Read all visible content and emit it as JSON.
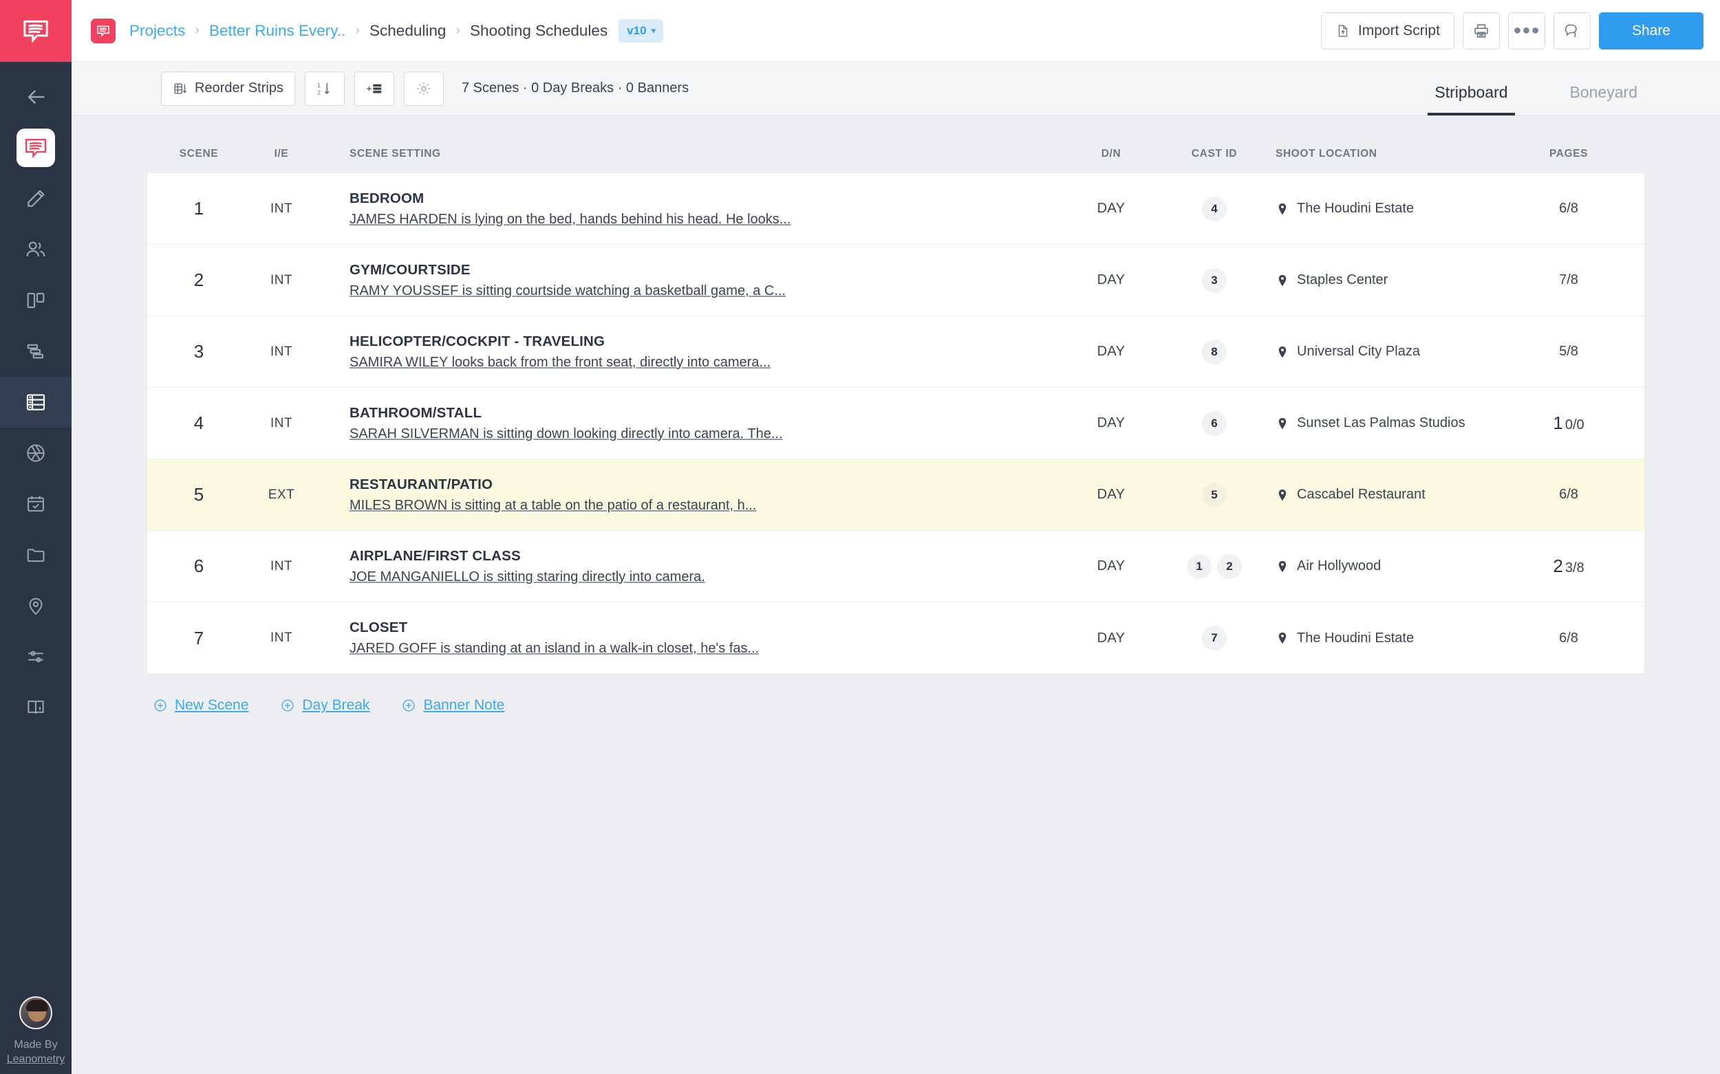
{
  "rail": {
    "brand_icon": "studiobinder-speech-logo",
    "items": [
      {
        "name": "back-arrow",
        "icon": "arrow-left-icon",
        "active": false
      },
      {
        "name": "script-logo",
        "icon": "speech-bubble-logo-icon",
        "active": false
      },
      {
        "name": "write",
        "icon": "pencil-icon",
        "active": false
      },
      {
        "name": "cast-crew",
        "icon": "people-icon",
        "active": false
      },
      {
        "name": "storyboard",
        "icon": "columns-icon",
        "active": false
      },
      {
        "name": "shot-list",
        "icon": "stacked-bars-icon",
        "active": false
      },
      {
        "name": "scheduling",
        "icon": "stripboard-icon",
        "active": true
      },
      {
        "name": "shooting",
        "icon": "camera-aperture-icon",
        "active": false
      },
      {
        "name": "calendar",
        "icon": "calendar-check-icon",
        "active": false
      },
      {
        "name": "files",
        "icon": "folder-icon",
        "active": false
      },
      {
        "name": "locations",
        "icon": "map-pin-icon",
        "active": false
      },
      {
        "name": "settings-sliders",
        "icon": "sliders-icon",
        "active": false
      },
      {
        "name": "help",
        "icon": "book-info-icon",
        "active": false
      }
    ],
    "footer": {
      "line1": "Made By",
      "line2": "Leanometry"
    }
  },
  "header": {
    "breadcrumbs": [
      {
        "label": "Projects",
        "link": true
      },
      {
        "label": "Better Ruins Every..",
        "link": true
      },
      {
        "label": "Scheduling",
        "link": false
      },
      {
        "label": "Shooting Schedules",
        "link": false
      }
    ],
    "separator": "›",
    "version_badge": {
      "label": "v10",
      "chevron": "⌄"
    },
    "import_button": "Import Script",
    "print_icon": "printer-icon",
    "more_icon": "ellipsis-icon",
    "comment_icon": "comment-bubble-icon",
    "share_button": "Share"
  },
  "toolbar": {
    "reorder_button": "Reorder Strips",
    "sort_icon": "sort-1-2-down-icon",
    "add_strip_icon": "add-strip-icon",
    "settings_icon": "gear-icon",
    "counts": "7 Scenes · 0 Day Breaks · 0 Banners",
    "tabs": [
      {
        "label": "Stripboard",
        "active": true
      },
      {
        "label": "Boneyard",
        "active": false
      }
    ]
  },
  "table": {
    "columns": [
      "SCENE",
      "I/E",
      "SCENE SETTING",
      "D/N",
      "CAST ID",
      "SHOOT LOCATION",
      "PAGES"
    ],
    "rows": [
      {
        "scene": "1",
        "ie": "INT",
        "title": "BEDROOM",
        "desc": "JAMES HARDEN is lying on the bed, hands behind his head. He looks...",
        "dn": "DAY",
        "cast": [
          "4"
        ],
        "location": "The Houdini Estate",
        "pages_whole": "",
        "pages_frac": "6/8",
        "highlighted": false
      },
      {
        "scene": "2",
        "ie": "INT",
        "title": "GYM/COURTSIDE",
        "desc": "RAMY YOUSSEF is sitting courtside watching a basketball game, a C...",
        "dn": "DAY",
        "cast": [
          "3"
        ],
        "location": "Staples Center",
        "pages_whole": "",
        "pages_frac": "7/8",
        "highlighted": false
      },
      {
        "scene": "3",
        "ie": "INT",
        "title": "HELICOPTER/COCKPIT - TRAVELING",
        "desc": "SAMIRA WILEY looks back from the front seat, directly into camera...",
        "dn": "DAY",
        "cast": [
          "8"
        ],
        "location": "Universal City Plaza",
        "pages_whole": "",
        "pages_frac": "5/8",
        "highlighted": false
      },
      {
        "scene": "4",
        "ie": "INT",
        "title": "BATHROOM/STALL",
        "desc": "SARAH SILVERMAN is sitting down looking directly into camera. The...",
        "dn": "DAY",
        "cast": [
          "6"
        ],
        "location": "Sunset Las Palmas Studios",
        "pages_whole": "1",
        "pages_frac": "0/0",
        "highlighted": false
      },
      {
        "scene": "5",
        "ie": "EXT",
        "title": "RESTAURANT/PATIO",
        "desc": "MILES BROWN is sitting at a table on the patio of a restaurant, h...",
        "dn": "DAY",
        "cast": [
          "5"
        ],
        "location": "Cascabel Restaurant",
        "pages_whole": "",
        "pages_frac": "6/8",
        "highlighted": true
      },
      {
        "scene": "6",
        "ie": "INT",
        "title": "AIRPLANE/FIRST CLASS",
        "desc": "JOE MANGANIELLO is sitting staring directly into camera.",
        "dn": "DAY",
        "cast": [
          "1",
          "2"
        ],
        "location": "Air Hollywood",
        "pages_whole": "2",
        "pages_frac": "3/8",
        "highlighted": false
      },
      {
        "scene": "7",
        "ie": "INT",
        "title": "CLOSET",
        "desc": "JARED GOFF is standing at an island in a walk-in closet, he's fas...",
        "dn": "DAY",
        "cast": [
          "7"
        ],
        "location": "The Houdini Estate",
        "pages_whole": "",
        "pages_frac": "6/8",
        "highlighted": false
      }
    ]
  },
  "footer_actions": [
    {
      "label": "New Scene",
      "icon": "plus-circle-icon"
    },
    {
      "label": "Day Break",
      "icon": "plus-circle-icon"
    },
    {
      "label": "Banner Note",
      "icon": "plus-circle-icon"
    }
  ],
  "colors": {
    "brand_red": "#f2415f",
    "accent_blue": "#2f9cf0",
    "link_blue": "#3aa9f5",
    "rail_dark": "#2b3445",
    "page_bg": "#eceef1",
    "highlight_row": "#fbfae1"
  }
}
